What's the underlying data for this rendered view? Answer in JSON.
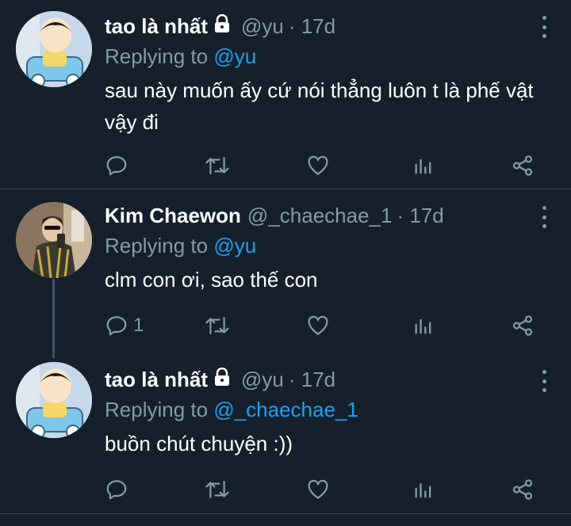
{
  "tweets": [
    {
      "name": "tao là nhất",
      "protected": true,
      "handle": "@yu",
      "time": "· 17d",
      "replying_prefix": "Replying to",
      "replying_to": "@yu",
      "text": "sau này muốn ấy cứ nói thẳng luôn t là phế vật vậy đi",
      "reply_count": ""
    },
    {
      "name": "Kim Chaewon",
      "protected": false,
      "handle": "@_chaechae_1",
      "time": "· 17d",
      "replying_prefix": "Replying to",
      "replying_to": "@yu",
      "text": "clm con ơi, sao thế con",
      "reply_count": "1"
    },
    {
      "name": "tao là nhất",
      "protected": true,
      "handle": "@yu",
      "time": "· 17d",
      "replying_prefix": "Replying to",
      "replying_to": "@_chaechae_1",
      "text": "buồn chút chuyện :))",
      "reply_count": ""
    }
  ],
  "icons": [
    "reply-icon",
    "retweet-icon",
    "like-icon",
    "analytics-icon",
    "share-icon",
    "lock-icon",
    "more-icon"
  ],
  "colors": {
    "background": "#15202b",
    "secondary_text": "#8899a6",
    "link": "#1da1f2",
    "divider": "#38444d"
  }
}
